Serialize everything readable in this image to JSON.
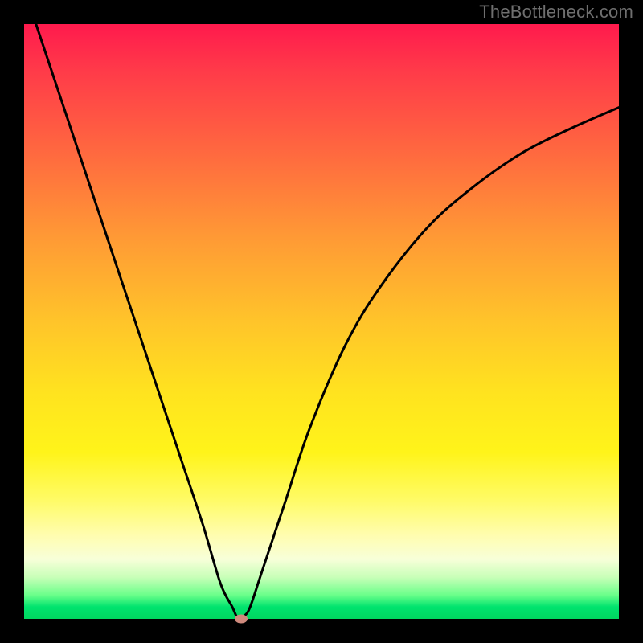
{
  "watermark": "TheBottleneck.com",
  "chart_data": {
    "type": "line",
    "title": "",
    "xlabel": "",
    "ylabel": "",
    "xlim": [
      0,
      100
    ],
    "ylim": [
      0,
      100
    ],
    "grid": false,
    "legend": false,
    "series": [
      {
        "name": "bottleneck-curve",
        "color": "#000000",
        "x": [
          2,
          6,
          10,
          14,
          18,
          22,
          26,
          30,
          33,
          35,
          36,
          37,
          38,
          40,
          44,
          48,
          54,
          60,
          68,
          76,
          84,
          92,
          100
        ],
        "y": [
          100,
          88,
          76,
          64,
          52,
          40,
          28,
          16,
          6,
          2,
          0,
          0.5,
          2,
          8,
          20,
          32,
          46,
          56,
          66,
          73,
          78.5,
          82.5,
          86
        ]
      }
    ],
    "marker": {
      "name": "optimal-point",
      "x": 36.5,
      "y": 0,
      "color": "#cf8a7d"
    }
  },
  "colors": {
    "frame": "#000000",
    "gradient_top": "#ff1a4d",
    "gradient_bottom": "#00d760",
    "curve": "#000000",
    "marker": "#cf8a7d"
  }
}
